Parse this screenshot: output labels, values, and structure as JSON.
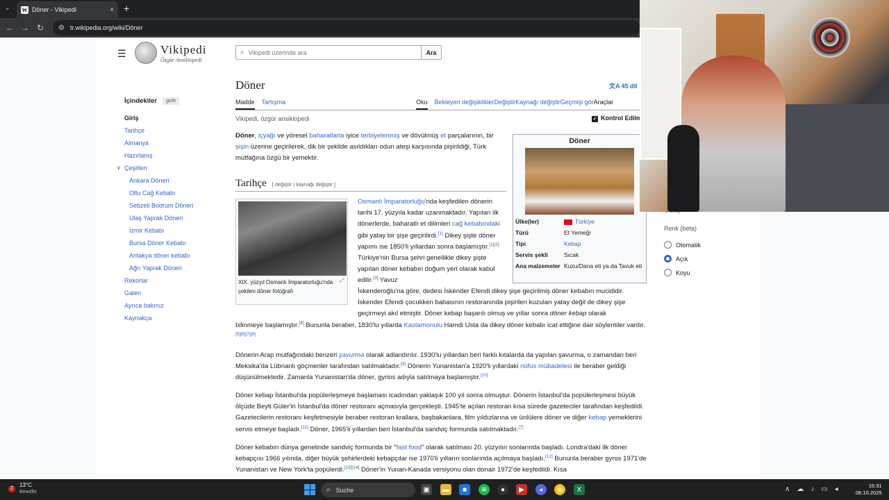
{
  "browser": {
    "tab_title": "Döner - Vikipedi",
    "tab_favicon": "W",
    "tab_close": "×",
    "new_tab": "+",
    "url": "tr.wikipedia.org/wiki/Döner"
  },
  "header": {
    "logo_title": "Vikipedi",
    "logo_tagline": "Özgür Ansiklopedi",
    "search_placeholder": "Vikipedi üzerinde ara",
    "search_button": "Ara"
  },
  "toc": {
    "title": "İçindekiler",
    "hide": "gizle",
    "items": [
      {
        "label": "Giriş"
      },
      {
        "label": "Tarihçe"
      },
      {
        "label": "Almanya"
      },
      {
        "label": "Hazırlanış"
      },
      {
        "label": "Çeşitleri"
      },
      {
        "label": "Ankara Döneri"
      },
      {
        "label": "Oltu Cağ Kebabı"
      },
      {
        "label": "Sebzeli Bodrum Döneri"
      },
      {
        "label": "Ulaş Yaprak Döneri"
      },
      {
        "label": "İzmir Kebabı"
      },
      {
        "label": "Bursa Döner Kebabı"
      },
      {
        "label": "Antakya döner kebabı"
      },
      {
        "label": "Ağrı Yaprak Döneri"
      },
      {
        "label": "Rekorlar"
      },
      {
        "label": "Galeri"
      },
      {
        "label": "Ayrıca bakınız"
      },
      {
        "label": "Kaynakça"
      }
    ]
  },
  "article": {
    "title": "Döner",
    "languages": "45 dil",
    "tabs_left": [
      "Madde",
      "Tartışma"
    ],
    "tabs_right": [
      "Oku",
      "Bekleyen değişiklikler",
      "Değiştir",
      "Kaynağı değiştir",
      "Geçmişi gör",
      "Araçlar"
    ],
    "subtitle": "Vikipedi, özgür ansiklopedi",
    "reviewed": "Kontrol Edilm",
    "section_tarihce": "Tarihçe",
    "section_edit": "[ değiştir | kaynağı değiştir ]",
    "thumb_caption": "XIX. yüzyıl Osmanlı İmparatorluğu'nda çekilen döner fotoğrafı"
  },
  "infobox": {
    "title": "Döner",
    "rows": [
      {
        "key": "Ülke(ler)",
        "value": "Türkiye"
      },
      {
        "key": "Türü",
        "value": "Et Yemeği"
      },
      {
        "key": "Tipi",
        "value": "Kebap"
      },
      {
        "key": "Servis şekli",
        "value": "Sıcak"
      },
      {
        "key": "Ana malzemeler",
        "value": "Kuzu/Dana eti ya da Tavuk eti"
      }
    ]
  },
  "appearance": {
    "partial_label": "Geniş",
    "color_title": "Renk (beta)",
    "options": [
      "Otomatik",
      "Açık",
      "Koyu"
    ],
    "selected": "Açık"
  },
  "taskbar": {
    "notification_count": "2",
    "temperature": "13°C",
    "weather": "Bewölkt",
    "search": "Suche",
    "time": "16:31",
    "date": "06.10.2025"
  },
  "colors": {
    "link": "#3366cc",
    "text": "#202122",
    "chrome_dark": "#202124",
    "radio_selected": "#3366cc"
  }
}
